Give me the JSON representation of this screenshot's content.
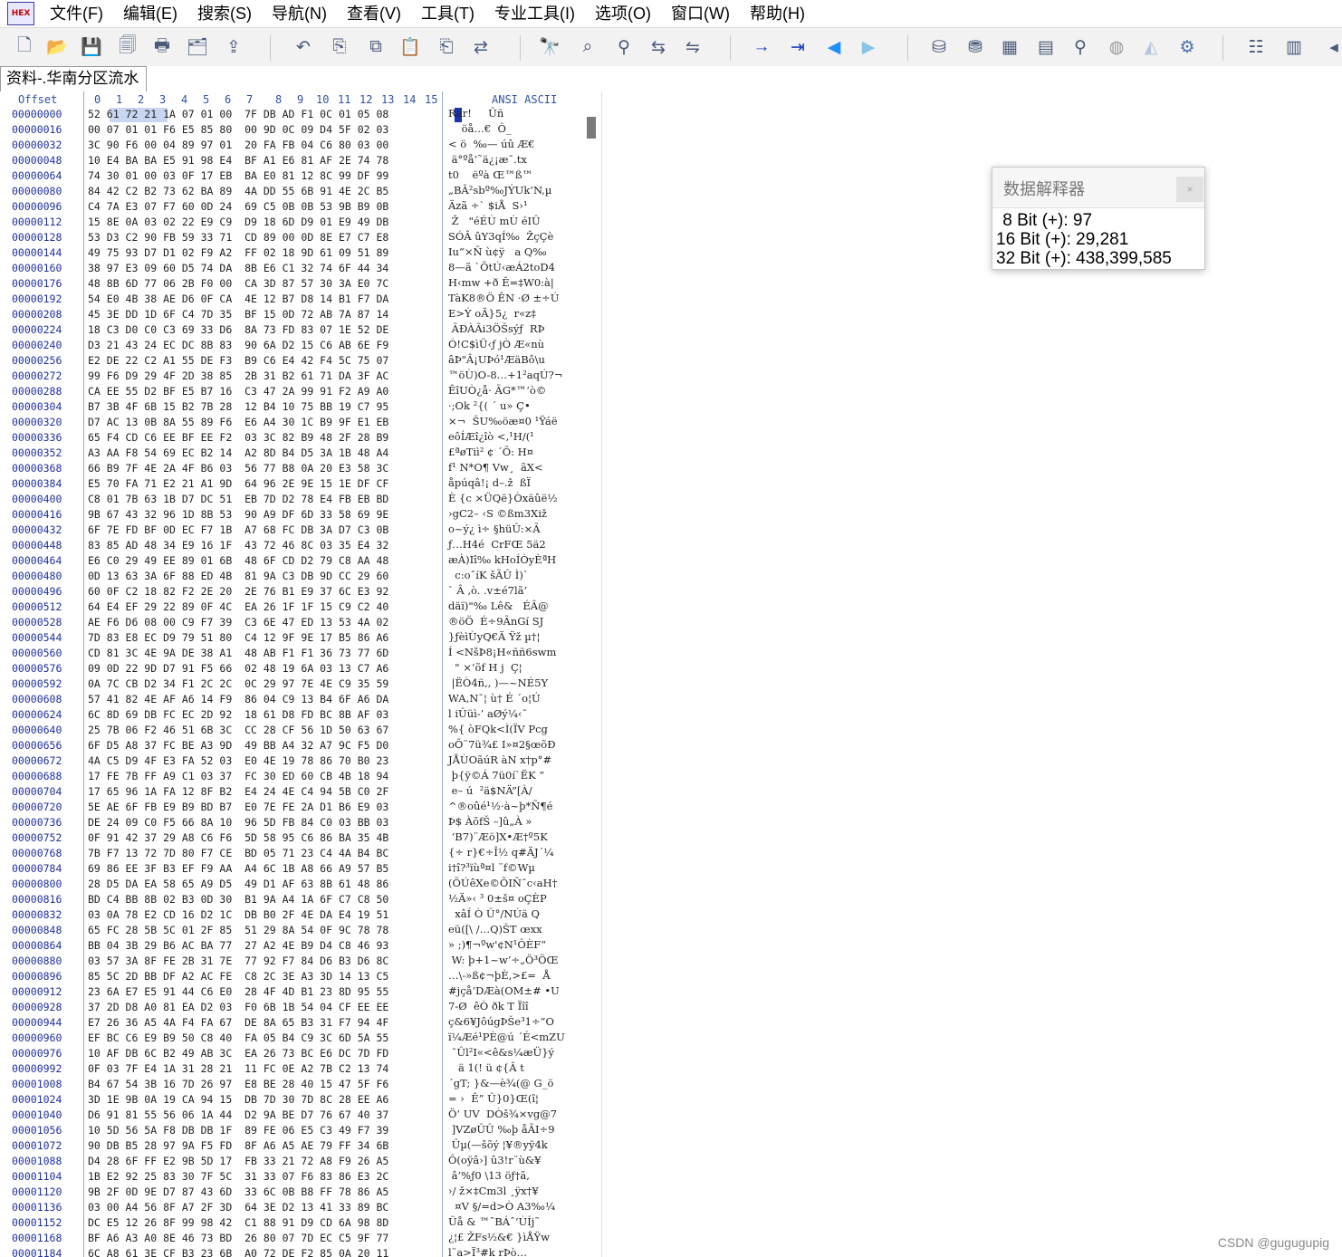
{
  "menu": {
    "items": [
      "文件(F)",
      "编辑(E)",
      "搜索(S)",
      "导航(N)",
      "查看(V)",
      "工具(T)",
      "专业工具(I)",
      "选项(O)",
      "窗口(W)",
      "帮助(H)"
    ]
  },
  "toolbar": {
    "icons": [
      "new-file-icon",
      "open-folder-icon",
      "save-icon",
      "save-all-icon",
      "print-icon",
      "properties-icon",
      "upload-icon",
      "undo-icon",
      "copy-icon",
      "cut-copy-icon",
      "paste-icon",
      "paste-write-icon",
      "convert-icon",
      "find-icon",
      "find-text-icon",
      "find-hex-icon",
      "replace-text-icon",
      "replace-hex-icon",
      "goto-offset-icon",
      "goto-position-icon",
      "back-icon",
      "forward-icon",
      "disk-open-icon",
      "disk-add-icon",
      "ram-icon",
      "calculator-icon",
      "magnifier-icon",
      "globe-icon",
      "chart-icon",
      "settings-gear-icon",
      "view-options-icon",
      "columns-icon",
      "more-arrow-icon"
    ]
  },
  "tab": {
    "label": "资料-.华南分区流水"
  },
  "header": {
    "offset_label": "Offset",
    "columns": [
      "0",
      "1",
      "2",
      "3",
      "4",
      "5",
      "6",
      "7",
      "8",
      "9",
      "10",
      "11",
      "12",
      "13",
      "14",
      "15"
    ],
    "ascii_label": "ANSI ASCII"
  },
  "rows": [
    {
      "o": "00000000",
      "h": "52 61 72 21 1A 07 01 00  7F DB AD F1 0C 01 05 08",
      "a": "Rar!     Û­ñ"
    },
    {
      "o": "00000016",
      "h": "00 07 01 01 F6 E5 85 80  00 9D 0C 09 D4 5F 02 03",
      "a": "    öå…€  Ô_"
    },
    {
      "o": "00000032",
      "h": "3C 90 F6 00 04 89 97 01  20 FA FB 04 C6 80 03 00",
      "a": "< ö  ‰— úû Æ€"
    },
    {
      "o": "00000048",
      "h": "10 E4 BA BA E5 91 98 E4  BF A1 E6 81 AF 2E 74 78",
      "a": " ä°ºå‘˜ä¿¡æ¯.tx"
    },
    {
      "o": "00000064",
      "h": "74 30 01 00 03 0F 17 EB  BA E0 81 12 8C 99 DF 99",
      "a": "t0    ëºà Œ™ß™"
    },
    {
      "o": "00000080",
      "h": "84 42 C2 B2 73 62 BA 89  4A DD 55 6B 91 4E 2C B5",
      "a": "„BÂ²sbº‰JÝUk‘N,µ"
    },
    {
      "o": "00000096",
      "h": "C4 7A E3 07 F7 60 0D 24  69 C5 0B 0B 53 9B B9 0B",
      "a": "Äzã ÷` $iÅ  S›¹"
    },
    {
      "o": "00000112",
      "h": "15 8E 0A 03 02 22 E9 C9  D9 18 6D D9 01 E9 49 DB",
      "a": " Ž   \"éÉÙ mÙ éIÛ"
    },
    {
      "o": "00000128",
      "h": "53 D3 C2 90 FB 59 33 71  CD 89 00 0D 8E E7 C7 E8",
      "a": "SÓÂ ûY3qÍ‰  ŽçÇè"
    },
    {
      "o": "00000144",
      "h": "49 75 93 D7 D1 02 F9 A2  FF 02 18 9D 61 09 51 89",
      "a": "Iu“×Ñ ù¢ÿ   a Q‰"
    },
    {
      "o": "00000160",
      "h": "38 97 E3 09 60 D5 74 DA  8B E6 C1 32 74 6F 44 34",
      "a": "8—ã `ÕtÚ‹æÁ2toD4"
    },
    {
      "o": "00000176",
      "h": "48 8B 6D 77 06 2B F0 00  CA 3D 87 57 30 3A E0 7C",
      "a": "H‹mw +ð Ê=‡W0:à|"
    },
    {
      "o": "00000192",
      "h": "54 E0 4B 38 AE D6 0F CA  4E 12 B7 D8 14 B1 F7 DA",
      "a": "TàK8®Ö ÊN ·Ø ±÷Ú"
    },
    {
      "o": "00000208",
      "h": "45 3E DD 1D 6F C4 7D 35  BF 15 0D 72 AB 7A 87 14",
      "a": "E>Ý oÄ}5¿  r«z‡"
    },
    {
      "o": "00000224",
      "h": "18 C3 D0 C0 C3 69 33 D6  8A 73 FD 83 07 1E 52 DE",
      "a": " ÃÐÀÃi3ÖŠsýƒ  RÞ"
    },
    {
      "o": "00000240",
      "h": "D3 21 43 24 EC DC 8B 83  90 6A D2 15 C6 AB 6E F9",
      "a": "Ó!C$ìÜ‹ƒ jÒ Æ«nù"
    },
    {
      "o": "00000256",
      "h": "E2 DE 22 C2 A1 55 DE F3  B9 C6 E4 42 F4 5C 75 07",
      "a": "âÞ\"Â¡UÞó¹ÆäBô\\u"
    },
    {
      "o": "00000272",
      "h": "99 F6 D9 29 4F 2D 38 85  2B 31 B2 61 71 DA 3F AC",
      "a": "™öÙ)O-8…+1²aqÚ?¬"
    },
    {
      "o": "00000288",
      "h": "CA EE 55 D2 BF E5 B7 16  C3 47 2A 99 91 F2 A9 A0",
      "a": "ÊîUÒ¿å· ÃG*™‘ò© "
    },
    {
      "o": "00000304",
      "h": "B7 3B 4F 6B 15 B2 7B 28  12 B4 10 75 BB 19 C7 95",
      "a": "·;Ok ²{( ´ u» Ç•"
    },
    {
      "o": "00000320",
      "h": "D7 AC 13 0B 8A 55 89 F6  E6 A4 30 1C B9 9F E1 EB",
      "a": "×¬  ŠU‰öæ¤0 ¹Ÿáë"
    },
    {
      "o": "00000336",
      "h": "65 F4 CD C6 EE BF EE F2  03 3C 82 B9 48 2F 28 B9",
      "a": "eôÍÆî¿îò <‚¹H/(¹"
    },
    {
      "o": "00000352",
      "h": "A3 AA F8 54 69 EC B2 14  A2 8D B4 D5 3A 1B 48 A4",
      "a": "£ªøTiì² ¢ ´Õ: H¤"
    },
    {
      "o": "00000368",
      "h": "66 B9 7F 4E 2A 4F B6 03  56 77 B8 0A 20 E3 58 3C",
      "a": "f¹ N*O¶ Vw¸  ãX<"
    },
    {
      "o": "00000384",
      "h": "E5 70 FA 71 E2 21 A1 9D  64 96 2E 9E 15 1E DF CF",
      "a": "åpúqâ!¡ d–.ž  ßÏ"
    },
    {
      "o": "00000400",
      "h": "C8 01 7B 63 1B D7 DC 51  EB 7D D2 78 E4 FB EB BD",
      "a": "È {c ×ÜQë}Òxäûë½"
    },
    {
      "o": "00000416",
      "h": "9B 67 43 32 96 1D 8B 53  90 A9 DF 6D 33 58 69 9E",
      "a": "›gC2– ‹S ©ßm3Xiž"
    },
    {
      "o": "00000432",
      "h": "6F 7E FD BF 0D EC F7 1B  A7 68 FC DB 3A D7 C3 0B",
      "a": "o~ý¿ ì÷ §hüÛ:×Ã"
    },
    {
      "o": "00000448",
      "h": "83 85 AD 48 34 E9 16 1F  43 72 46 8C 03 35 E4 32",
      "a": "ƒ…­H4é  CrFŒ 5ä2"
    },
    {
      "o": "00000464",
      "h": "E6 C0 29 49 EE 89 01 6B  48 6F CD D2 79 C8 AA 48",
      "a": "æÀ)Iî‰ kHoÍÒyÈªH"
    },
    {
      "o": "00000480",
      "h": "0D 13 63 3A 6F 88 ED 4B  81 9A C3 DB 9D CC 29 60",
      "a": "  c:oˆíK šÃÛ Ì)`"
    },
    {
      "o": "00000496",
      "h": "60 0F C2 18 82 F2 2E 20  2E 76 B1 E9 37 6C E3 92",
      "a": "` Â ‚ò. .v±é7lã’"
    },
    {
      "o": "00000512",
      "h": "64 E4 EF 29 22 89 0F 4C  EA 26 1F 1F 15 C9 C2 40",
      "a": "däï)\"‰ Lê&   ÉÂ@"
    },
    {
      "o": "00000528",
      "h": "AE F6 D6 08 00 C9 F7 39  C3 6E 47 ED 13 53 4A 02",
      "a": "®öÖ  É÷9ÃnGí SJ"
    },
    {
      "o": "00000544",
      "h": "7D 83 E8 EC D9 79 51 80  C4 12 9F 9E 17 B5 86 A6",
      "a": "}ƒèìÙyQ€Ä Ÿž µ†¦"
    },
    {
      "o": "00000560",
      "h": "CD 81 3C 4E 9A DE 38 A1  48 AB F1 F1 36 73 77 6D",
      "a": "Í <NšÞ8¡H«ññ6swm"
    },
    {
      "o": "00000576",
      "h": "09 0D 22 9D D7 91 F5 66  02 48 19 6A 03 13 C7 A6",
      "a": "  \" ×‘õf H j  Ç¦"
    },
    {
      "o": "00000592",
      "h": "0A 7C CB D2 34 F1 2C 2C  0C 29 97 7E 4E C9 35 59",
      "a": " |ËÒ4ñ,, )—~NÉ5Y"
    },
    {
      "o": "00000608",
      "h": "57 41 82 4E AF A6 14 F9  86 04 C9 13 B4 6F A6 DA",
      "a": "WA‚N¯¦ ù† É ´o¦Ú"
    },
    {
      "o": "00000624",
      "h": "6C 8D 69 DB FC EC 2D 92  18 61 D8 FD BC 8B AF 03",
      "a": "l iÛüì-’ aØý¼‹¯"
    },
    {
      "o": "00000640",
      "h": "25 7B 06 F2 46 51 6B 3C  CC 28 CF 56 1D 50 63 67",
      "a": "%{ òFQk<Ì(ÏV Pcg"
    },
    {
      "o": "00000656",
      "h": "6F D5 A8 37 FC BE A3 9D  49 BB A4 32 A7 9C F5 D0",
      "a": "oÕ¨7ü¾£ I»¤2§œõÐ"
    },
    {
      "o": "00000672",
      "h": "4A C5 D9 4F E3 FA 52 03  E0 4E 19 78 86 70 B0 23",
      "a": "JÅÙOãúR àN x†p°#"
    },
    {
      "o": "00000688",
      "h": "17 FE 7B FF A9 C1 03 37  FC 30 ED 60 CB 4B 18 94",
      "a": " þ{ÿ©Á 7ü0í`ËK ”"
    },
    {
      "o": "00000704",
      "h": "17 65 96 1A FA 12 8F B2  E4 24 4E C4 94 5B C0 2F",
      "a": " e– ú  ²ä$NÄ”[À/"
    },
    {
      "o": "00000720",
      "h": "5E AE 6F FB E9 B9 BD B7  E0 7E FE 2A D1 B6 E9 03",
      "a": "^®oûé¹½·à~þ*Ñ¶é"
    },
    {
      "o": "00000736",
      "h": "DE 24 09 C0 F5 66 8A 10  96 5D FB 84 C0 03 BB 03",
      "a": "Þ$ ÀõfŠ –]û„À »"
    },
    {
      "o": "00000752",
      "h": "0F 91 42 37 29 A8 C6 F6  5D 58 95 C6 86 BA 35 4B",
      "a": " ‘B7)¨Æö]X•Æ†º5K"
    },
    {
      "o": "00000768",
      "h": "7B F7 13 72 7D 80 F7 CE  BD 05 71 23 C4 4A B4 BC",
      "a": "{÷ r}€÷Î½ q#ÄJ´¼"
    },
    {
      "o": "00000784",
      "h": "69 86 EE 3F B3 EF F9 AA  A4 6C 1B A8 66 A9 57 B5",
      "a": "i†î?³ïùª¤l ¨f©Wµ"
    },
    {
      "o": "00000800",
      "h": "28 D5 DA EA 58 65 A9 D5  49 D1 AF 63 8B 61 48 86",
      "a": "(ÕÚêXe©ÕIÑ¯c‹aH†"
    },
    {
      "o": "00000816",
      "h": "BD C4 BB 8B 02 B3 0D 30  B1 9A A4 1A 6F C7 C8 50",
      "a": "½Ä»‹ ³ 0±š¤ oÇÈP"
    },
    {
      "o": "00000832",
      "h": "03 0A 78 E2 CD 16 D2 1C  DB B0 2F 4E DA E4 19 51",
      "a": "  xâÍ Ò Û°/NÚä Q"
    },
    {
      "o": "00000848",
      "h": "65 FC 28 5B 5C 01 2F 85  51 29 8A 54 0F 9C 78 78",
      "a": "eü([\\ /…Q)ŠT œxx"
    },
    {
      "o": "00000864",
      "h": "BB 04 3B 29 B6 AC BA 77  27 A2 4E B9 D4 C8 46 93",
      "a": "» ;)¶¬ºw'¢N¹ÔÈF“"
    },
    {
      "o": "00000880",
      "h": "03 57 3A 8F FE 2B 31 7E  77 92 F7 84 D6 B3 D6 8C",
      "a": " W: þ+1~w’÷„Ö³ÖŒ"
    },
    {
      "o": "00000896",
      "h": "85 5C 2D BB DF A2 AC FE  C8 2C 3E A3 3D 14 13 C5",
      "a": "…\\-»ß¢¬þÈ,>£=  Å"
    },
    {
      "o": "00000912",
      "h": "23 6A E7 E5 91 44 C6 E0  28 4F 4D B1 23 8D 95 55",
      "a": "#jçå‘DÆà(OM±# •U"
    },
    {
      "o": "00000928",
      "h": "37 2D D8 A0 81 EA D2 03  F0 6B 1B 54 04 CF EE EE",
      "a": "7-Ø  êÒ ðk T Ïîî"
    },
    {
      "o": "00000944",
      "h": "E7 26 36 A5 4A F4 FA 67  DE 8A 65 B3 31 F7 94 4F",
      "a": "ç&6¥JôúgÞŠe³1÷”O"
    },
    {
      "o": "00000960",
      "h": "EF BC C6 E9 B9 50 C8 40  FA 05 B4 C9 3C 6D 5A 55",
      "a": "ï¼Æé¹PÈ@ú ´É<mZU"
    },
    {
      "o": "00000976",
      "h": "10 AF DB 6C B2 49 AB 3C  EA 26 73 BC E6 DC 7D FD",
      "a": " ¯Ûl²I«<ê&s¼æÜ}ý"
    },
    {
      "o": "00000992",
      "h": "0F 03 7F E4 1A 31 28 21  11 FC 0E A2 7B C2 13 74",
      "a": "   ä 1(! ü ¢{Â t"
    },
    {
      "o": "00001008",
      "h": "B4 67 54 3B 16 7D 26 97  E8 BE 28 40 15 47 5F F6",
      "a": "´gT; }&—è¾(@ G_ö"
    },
    {
      "o": "00001024",
      "h": "3D 1E 9B 0A 19 CA 94 15  DB 7D 30 7D 8C 28 EE A6",
      "a": "= ›  Ê” Û}0}Œ(î¦"
    },
    {
      "o": "00001040",
      "h": "D6 91 81 55 56 06 1A 44  D2 9A BE D7 76 67 40 37",
      "a": "Ö‘ UV  DÒš¾×vg@7"
    },
    {
      "o": "00001056",
      "h": "10 5D 56 5A F8 DB DB 1F  89 FE 06 E5 C3 49 F7 39",
      "a": " ]VZøÛÛ ‰þ åÃI÷9"
    },
    {
      "o": "00001072",
      "h": "90 DB B5 28 97 9A F5 FD  8F A6 A5 AE 79 FF 34 6B",
      "a": " Ûµ(—šõý ¦¥®yÿ4k"
    },
    {
      "o": "00001088",
      "h": "D4 28 6F FF E2 9B 5D 17  FB 33 21 72 A8 F9 26 A5",
      "a": "Ô(oÿâ›] û3!r¨ù&¥"
    },
    {
      "o": "00001104",
      "h": "1B E2 92 25 83 30 7F 5C  31 33 07 F6 83 86 E3 2C",
      "a": " â’%ƒ0 \\13 öƒ†ã,"
    },
    {
      "o": "00001120",
      "h": "9B 2F 0D 9E D7 87 43 6D  33 6C 0B B8 FF 78 86 A5",
      "a": "›/ ž×‡Cm3l ¸ÿx†¥"
    },
    {
      "o": "00001136",
      "h": "03 00 A4 56 8F A7 2F 3D  64 3E D2 13 41 33 89 BC",
      "a": "  ¤V §/=d>Ò A3‰¼"
    },
    {
      "o": "00001152",
      "h": "DC E5 12 26 8F 99 98 42  C1 88 91 D9 CD 6A 98 8D",
      "a": "Üå & ™˜BÁˆ‘ÙÍj˜"
    },
    {
      "o": "00001168",
      "h": "BF A6 A3 A0 8E 46 73 BD  26 80 07 7D EC C5 9F 77",
      "a": "¿¦£ ŽFs½&€ }ìÅŸw"
    },
    {
      "o": "00001184",
      "h": "6C A8 61 3E CF B3 23 6B  A0 72 DE F2 85 0A 20 11",
      "a": "l¨a>Ï³#k rÞò…  "
    }
  ],
  "interpreter": {
    "title": "数据解释器",
    "close": "×",
    "bit8": " 8 Bit (+): 97",
    "bit16": "16 Bit (+): 29,281",
    "bit32": "32 Bit (+): 438,399,585"
  },
  "watermark": "CSDN @gugugupig"
}
